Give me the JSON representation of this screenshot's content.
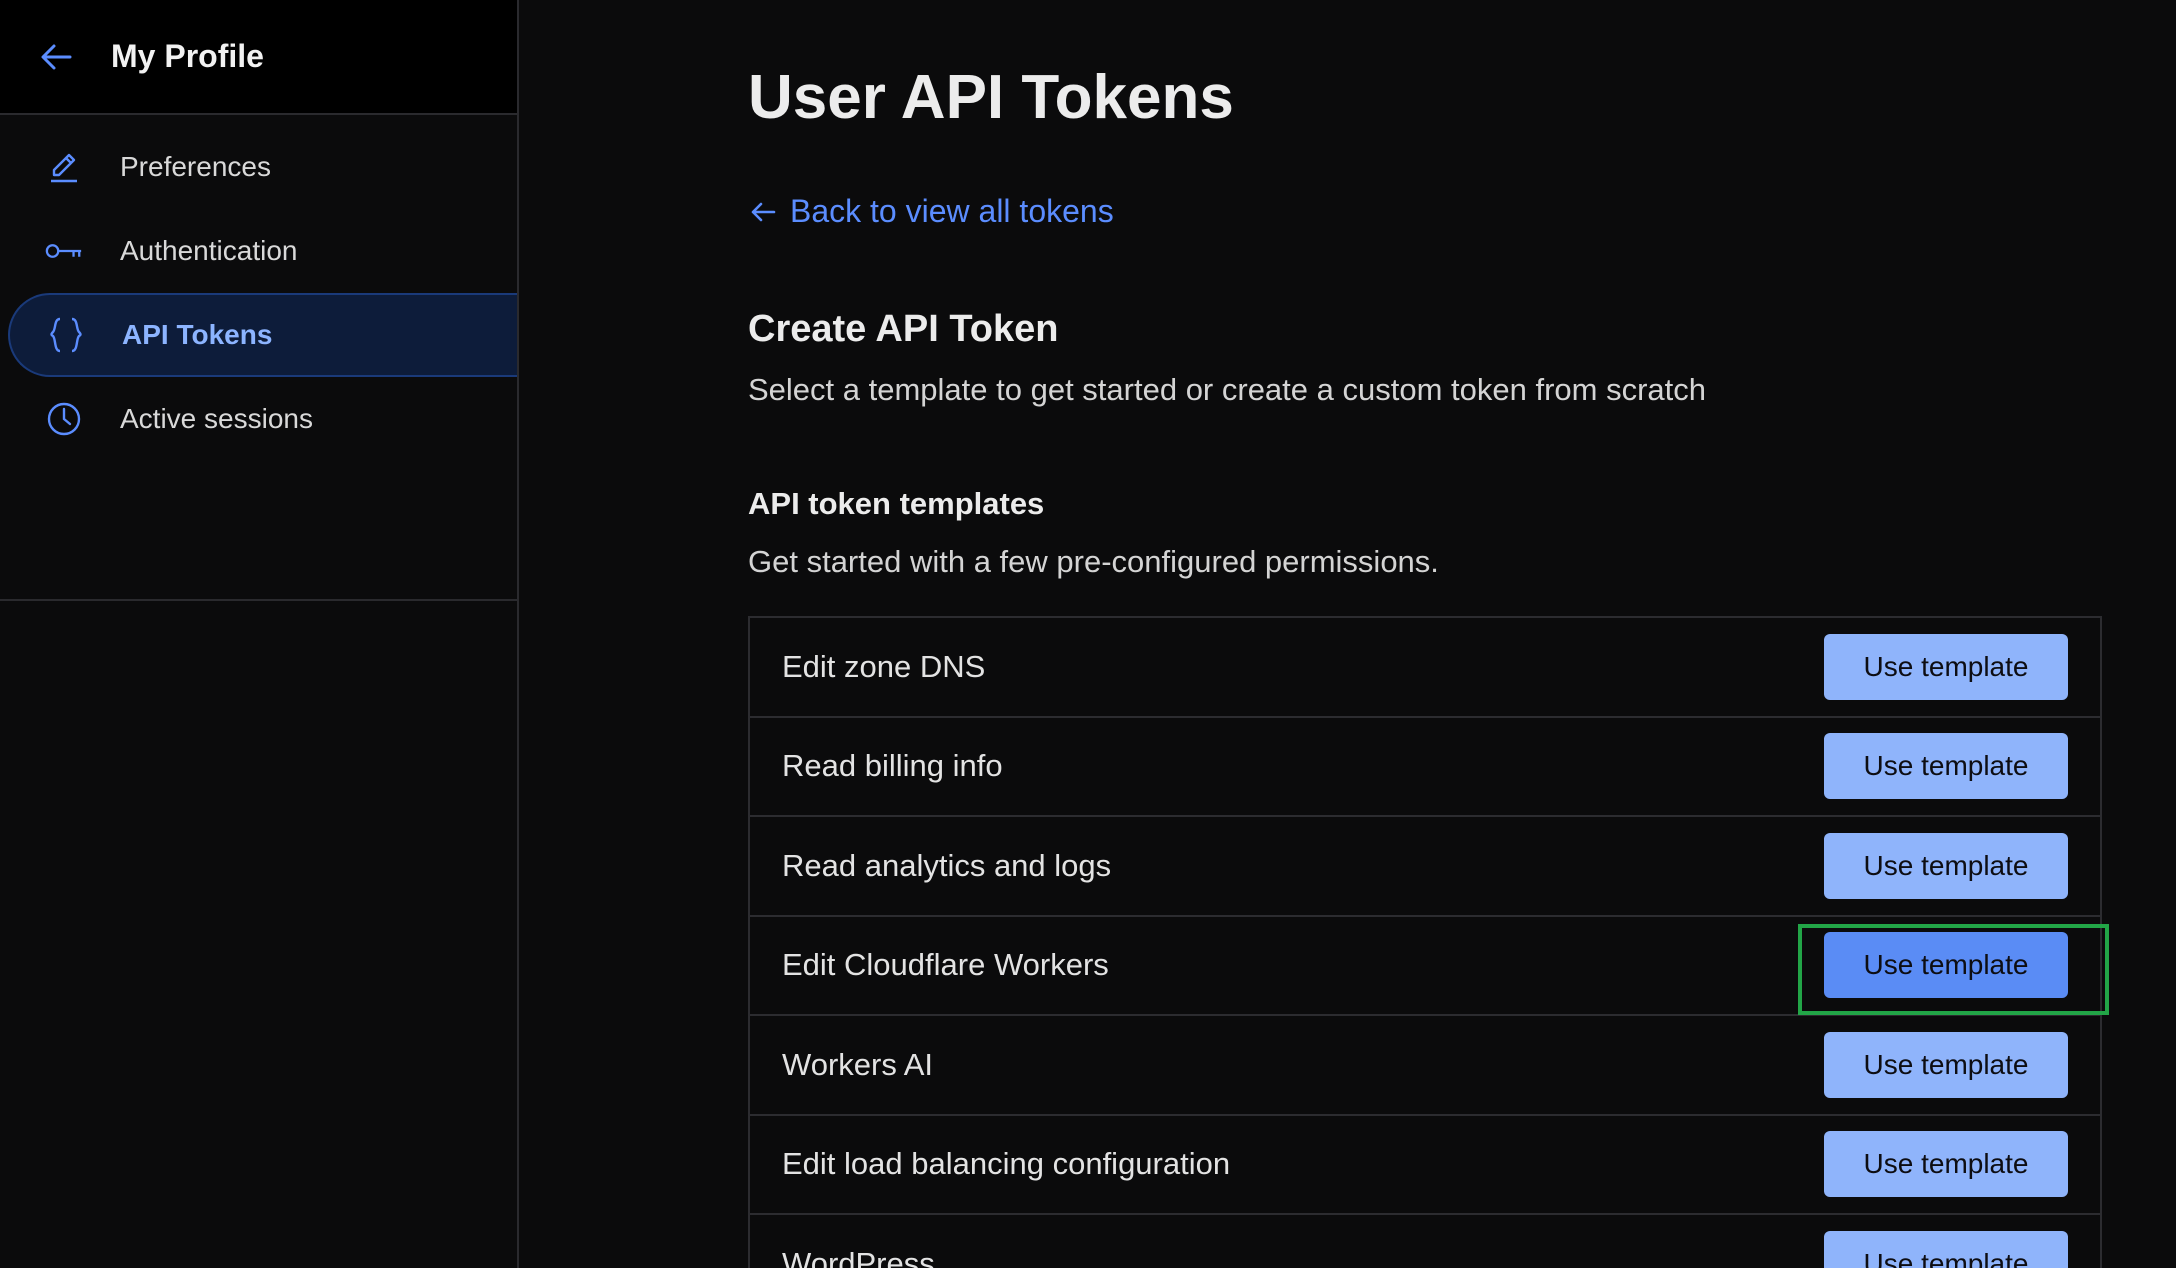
{
  "sidebar": {
    "title": "My Profile",
    "items": [
      {
        "label": "Preferences",
        "icon": "pencil-icon",
        "active": false
      },
      {
        "label": "Authentication",
        "icon": "key-icon",
        "active": false
      },
      {
        "label": "API Tokens",
        "icon": "braces-icon",
        "active": true
      },
      {
        "label": "Active sessions",
        "icon": "clock-icon",
        "active": false
      }
    ]
  },
  "main": {
    "title": "User API Tokens",
    "back_link": "Back to view all tokens",
    "section_title": "Create API Token",
    "section_subtitle": "Select a template to get started or create a custom token from scratch",
    "templates_title": "API token templates",
    "templates_subtitle": "Get started with a few pre-configured permissions.",
    "button_label": "Use template",
    "templates": [
      {
        "name": "Edit zone DNS"
      },
      {
        "name": "Read billing info"
      },
      {
        "name": "Read analytics and logs"
      },
      {
        "name": "Edit Cloudflare Workers",
        "highlighted": true
      },
      {
        "name": "Workers AI"
      },
      {
        "name": "Edit load balancing configuration"
      },
      {
        "name": "WordPress"
      }
    ]
  },
  "colors": {
    "accent": "#5b8dff",
    "button_bg": "#8fb4fb",
    "button_focus_bg": "#5a8cf5",
    "highlight_border": "#22a547",
    "active_nav_bg": "#0d1c3a"
  }
}
